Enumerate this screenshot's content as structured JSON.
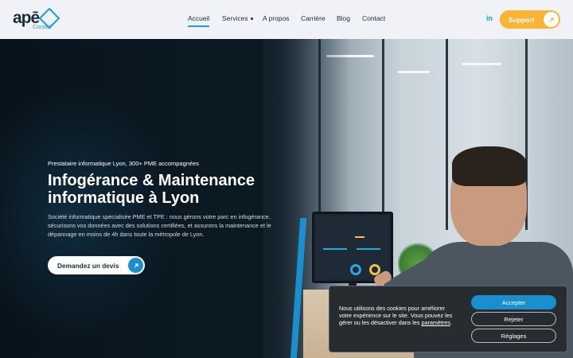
{
  "header": {
    "logo": {
      "main": "apē",
      "sub": "Conseil"
    },
    "nav": [
      {
        "label": "Accueil",
        "active": true
      },
      {
        "label": "Services",
        "active": false,
        "has_dropdown": true
      },
      {
        "label": "A propos",
        "active": false
      },
      {
        "label": "Carrière",
        "active": false
      },
      {
        "label": "Blog",
        "active": false
      },
      {
        "label": "Contact",
        "active": false
      }
    ],
    "linkedin_label": "in",
    "support_label": "Support"
  },
  "hero": {
    "kicker": "Prestataire informatique Lyon, 300+ PME accompagnées",
    "title": "Infogérance & Maintenance informatique à Lyon",
    "description": "Société informatique spécialisée PME et TPE : nous gérons votre parc en infogérance, sécurisons vos données avec des solutions certifiées, et assurons la maintenance et le dépannage en moins de 4h dans toute la métropole de Lyon.",
    "cta_label": "Demandez un devis"
  },
  "cookie_banner": {
    "text_before_link": "Nous utilisons des cookies pour améliorer votre expérience sur le site. Vous pouvez les gérer ou les désactiver dans les ",
    "link_label": "paramètres",
    "text_after_link": ".",
    "accept_label": "Accepter",
    "reject_label": "Rejeter",
    "settings_label": "Réglages"
  },
  "colors": {
    "accent_blue": "#1a8fd0",
    "support_yellow": "#f9b434",
    "header_bg": "#f1f2f8"
  }
}
